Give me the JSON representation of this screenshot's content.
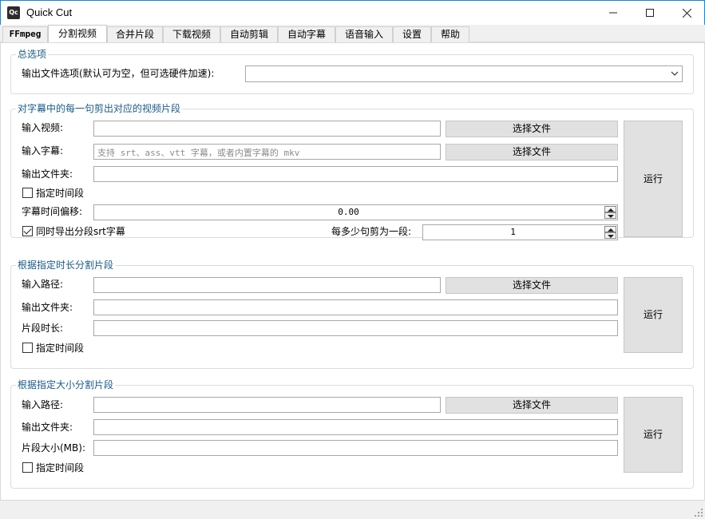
{
  "window": {
    "title": "Quick Cut",
    "icon_text": "Qc"
  },
  "tabs": [
    {
      "label": "FFmpeg"
    },
    {
      "label": "分割视频"
    },
    {
      "label": "合并片段"
    },
    {
      "label": "下载视频"
    },
    {
      "label": "自动剪辑"
    },
    {
      "label": "自动字幕"
    },
    {
      "label": "语音输入"
    },
    {
      "label": "设置"
    },
    {
      "label": "帮助"
    }
  ],
  "active_tab": "分割视频",
  "general": {
    "title": "总选项",
    "output_options_label": "输出文件选项(默认可为空，但可选硬件加速):",
    "output_options_value": ""
  },
  "subtitle_split": {
    "title": "对字幕中的每一句剪出对应的视频片段",
    "input_video_label": "输入视频:",
    "input_video_value": "",
    "input_subtitle_label": "输入字幕:",
    "input_subtitle_placeholder": "支持 srt、ass、vtt 字幕，或者内置字幕的 mkv",
    "output_folder_label": "输出文件夹:",
    "output_folder_value": "",
    "time_range_label": "指定时间段",
    "time_range_checked": false,
    "offset_label": "字幕时间偏移:",
    "offset_value": "0.00",
    "export_srt_label": "同时导出分段srt字幕",
    "export_srt_checked": true,
    "per_segment_label": "每多少句剪为一段:",
    "per_segment_value": "1",
    "choose_file": "选择文件",
    "run": "运行"
  },
  "duration_split": {
    "title": "根据指定时长分割片段",
    "input_path_label": "输入路径:",
    "output_folder_label": "输出文件夹:",
    "segment_duration_label": "片段时长:",
    "time_range_label": "指定时间段",
    "time_range_checked": false,
    "choose_file": "选择文件",
    "run": "运行"
  },
  "size_split": {
    "title": "根据指定大小分割片段",
    "input_path_label": "输入路径:",
    "output_folder_label": "输出文件夹:",
    "segment_size_label": "片段大小(MB):",
    "time_range_label": "指定时间段",
    "time_range_checked": false,
    "choose_file": "选择文件",
    "run": "运行"
  },
  "icons": {
    "minimize": "minimize-icon",
    "maximize": "maximize-icon",
    "close": "close-icon",
    "dropdown": "chevron-down-icon",
    "spin_up": "arrow-up-icon",
    "spin_down": "arrow-down-icon",
    "resize_grip": "resize-grip-icon"
  }
}
